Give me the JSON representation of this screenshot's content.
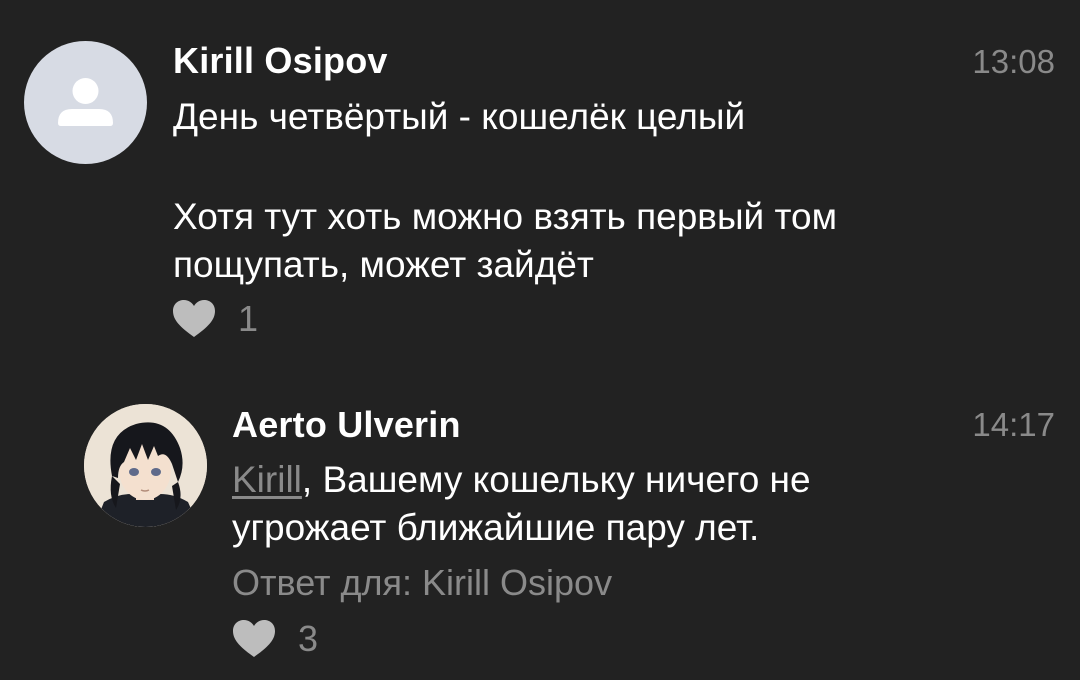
{
  "comments": [
    {
      "author": "Kirill Osipov",
      "time": "13:08",
      "lines": [
        "День четвёртый - кошелёк целый",
        "Хотя тут хоть можно взять первый том",
        "пощупать, может зайдёт"
      ],
      "likes": "1",
      "avatar_icon": "user-placeholder-icon",
      "heart_icon": "heart-icon"
    },
    {
      "author": "Aerto Ulverin",
      "time": "14:17",
      "mention": "Kirill",
      "line1_rest": ", Вашему кошельку ничего не",
      "line2": "угрожает ближайшие пару лет.",
      "reply_to": "Ответ для: Kirill Osipov",
      "likes": "3",
      "avatar_icon": "anime-character-avatar",
      "heart_icon": "heart-icon"
    }
  ],
  "colors": {
    "background": "#222222",
    "text": "#ffffff",
    "muted": "#8a8a8a",
    "heart": "#bdbdbd",
    "placeholder_avatar_bg": "#d7dbe4"
  }
}
